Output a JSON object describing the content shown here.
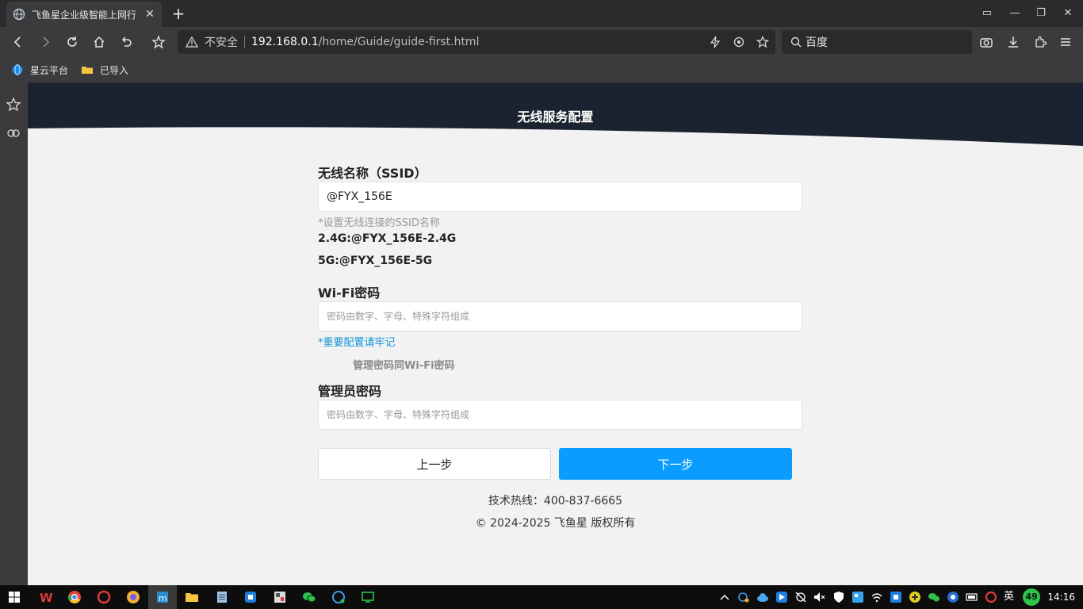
{
  "browser": {
    "tab_title": "飞鱼星企业级智能上网行",
    "url_security_label": "不安全",
    "url_host": "192.168.0.1",
    "url_path": "/home/Guide/guide-first.html",
    "search_engine": "百度",
    "bookmarks": [
      {
        "label": "星云平台",
        "icon": "globe-icon"
      },
      {
        "label": "已导入",
        "icon": "folder-icon"
      }
    ]
  },
  "page": {
    "header_title": "无线服务配置",
    "ssid_label": "无线名称（SSID）",
    "ssid_value": "@FYX_156E",
    "ssid_hint": "*设置无线连接的SSID名称",
    "band_24": "2.4G:@FYX_156E-2.4G",
    "band_5": "5G:@FYX_156E-5G",
    "wifi_pw_label": "Wi-Fi密码",
    "wifi_pw_placeholder": "密码由数字、字母、特殊字符组成",
    "wifi_pw_tip": "*重要配置请牢记",
    "same_pw_label": "管理密码同Wi-Fi密码",
    "admin_pw_label": "管理员密码",
    "admin_pw_placeholder": "密码由数字、字母、特殊字符组成",
    "prev_button": "上一步",
    "next_button": "下一步",
    "hotline": "技术热线：400-837-6665",
    "copyright": "© 2024-2025 飞鱼星 版权所有"
  },
  "taskbar": {
    "language": "英",
    "battery_badge": "49",
    "clock": "14:16"
  },
  "colors": {
    "header_dark": "#1c2330",
    "primary": "#0a9cff",
    "tip_blue": "#1296db"
  }
}
